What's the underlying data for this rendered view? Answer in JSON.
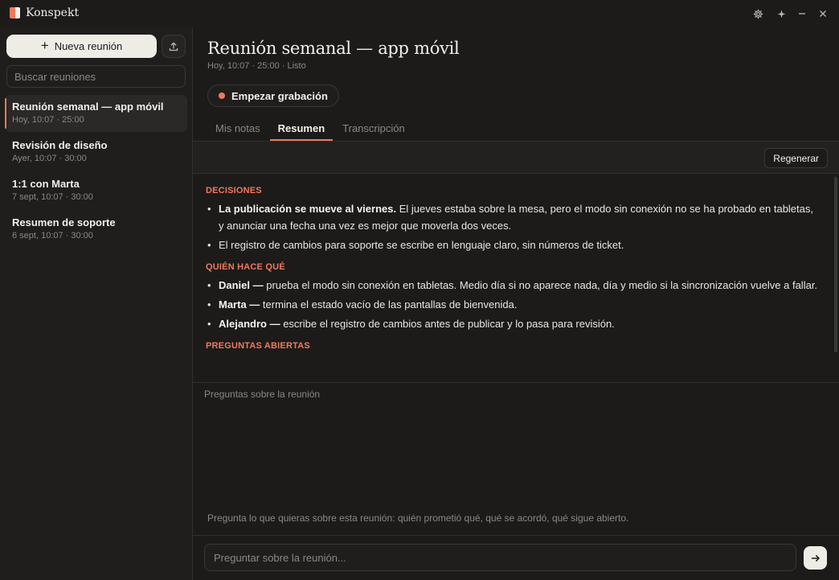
{
  "app": {
    "title": "Konspekt"
  },
  "colors": {
    "accent": "#ee7a5c",
    "background": "#1c1b1a",
    "sidebar": "#1f1e1d"
  },
  "window_controls": [
    {
      "icon": "gear-icon"
    },
    {
      "icon": "sparkle-icon"
    },
    {
      "icon": "minimize-icon"
    },
    {
      "icon": "close-icon"
    }
  ],
  "sidebar": {
    "new_meeting_label": "Nueva reunión",
    "export_icon": "upload-icon",
    "search_placeholder": "Buscar reuniones",
    "meetings": [
      {
        "title": "Reunión semanal — app móvil",
        "meta": "Hoy, 10:07 · 25:00",
        "active": true
      },
      {
        "title": "Revisión de diseño",
        "meta": "Ayer, 10:07 · 30:00",
        "active": false
      },
      {
        "title": "1:1 con Marta",
        "meta": "7 sept, 10:07 · 30:00",
        "active": false
      },
      {
        "title": "Resumen de soporte",
        "meta": "6 sept, 10:07 · 30:00",
        "active": false
      }
    ]
  },
  "main": {
    "title": "Reunión semanal — app móvil",
    "meta": "Hoy, 10:07 · 25:00 · Listo",
    "record_label": "Empezar grabación",
    "tabs": [
      {
        "label": "Mis notas",
        "active": false
      },
      {
        "label": "Resumen",
        "active": true
      },
      {
        "label": "Transcripción",
        "active": false
      }
    ],
    "regenerate_label": "Regenerar",
    "summary": {
      "decisions_heading": "DECISIONES",
      "decisions": [
        {
          "bold": "La publicación se mueve al viernes.",
          "text": " El jueves estaba sobre la mesa, pero el modo sin conexión no se ha probado en tabletas, y anunciar una fecha una vez es mejor que moverla dos veces."
        },
        {
          "bold": "",
          "text": "El registro de cambios para soporte se escribe en lenguaje claro, sin números de ticket."
        }
      ],
      "owners_heading": "QUIÉN HACE QUÉ",
      "owners": [
        {
          "bold": "Daniel —",
          "text": " prueba el modo sin conexión en tabletas. Medio día si no aparece nada, día y medio si la sincronización vuelve a fallar."
        },
        {
          "bold": "Marta —",
          "text": " termina el estado vacío de las pantallas de bienvenida."
        },
        {
          "bold": "Alejandro —",
          "text": " escribe el registro de cambios antes de publicar y lo pasa para revisión."
        }
      ],
      "open_heading": "PREGUNTAS ABIERTAS"
    },
    "chat": {
      "label": "Preguntas sobre la reunión",
      "hint": "Pregunta lo que quieras sobre esta reunión: quién prometió qué, qué se acordó, qué sigue abierto.",
      "input_placeholder": "Preguntar sobre la reunión...",
      "send_icon": "arrow-right-icon"
    }
  }
}
